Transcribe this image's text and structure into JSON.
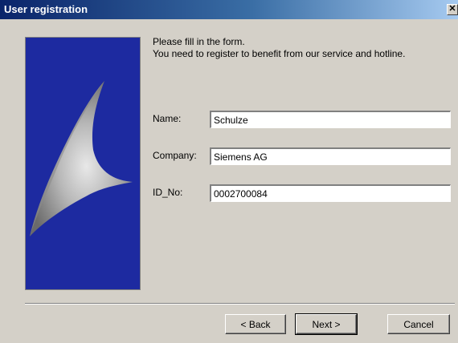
{
  "window": {
    "title": "User registration",
    "close_glyph": "✕"
  },
  "intro": {
    "line1": "Please fill in the form.",
    "line2": "You need to register to benefit from our service and hotline."
  },
  "form": {
    "name_label": "Name:",
    "name_value": "Schulze",
    "company_label": "Company:",
    "company_value": "Siemens AG",
    "id_label": "ID_No:",
    "id_value": "0002700084"
  },
  "buttons": {
    "back": "< Back",
    "next": "Next >",
    "cancel": "Cancel"
  },
  "colors": {
    "titlebar_start": "#0a246a",
    "titlebar_end": "#a6caf0",
    "panel_bg": "#1d2aa0",
    "dialog_bg": "#d4d0c8"
  },
  "icons": {
    "close": "close-icon",
    "decorative": "sail-logo-graphic"
  }
}
